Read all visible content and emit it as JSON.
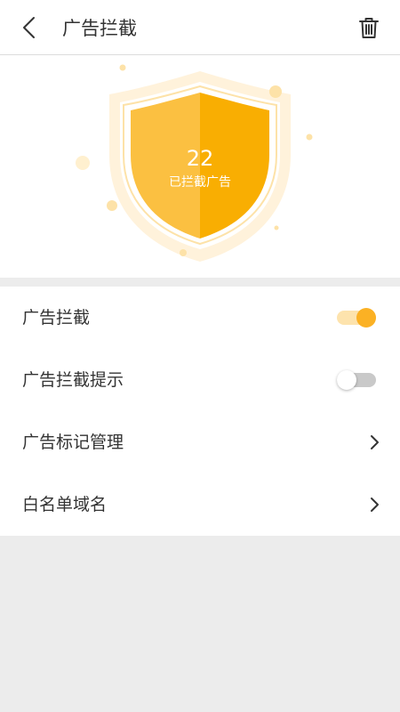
{
  "header": {
    "title": "广告拦截",
    "back_icon": "chevron-left-icon",
    "trash_icon": "trash-icon"
  },
  "hero": {
    "blocked_count": "22",
    "blocked_label": "已拦截广告"
  },
  "settings": {
    "items": [
      {
        "label": "广告拦截",
        "control": "toggle",
        "state": "on"
      },
      {
        "label": "广告拦截提示",
        "control": "toggle",
        "state": "off"
      },
      {
        "label": "广告标记管理",
        "control": "chevron"
      },
      {
        "label": "白名单域名",
        "control": "chevron"
      }
    ]
  },
  "colors": {
    "accent": "#fbb124",
    "shield_light": "#fbc041",
    "shield_dark": "#f9ae02",
    "halo": "#fff2db",
    "background": "#ececec"
  }
}
